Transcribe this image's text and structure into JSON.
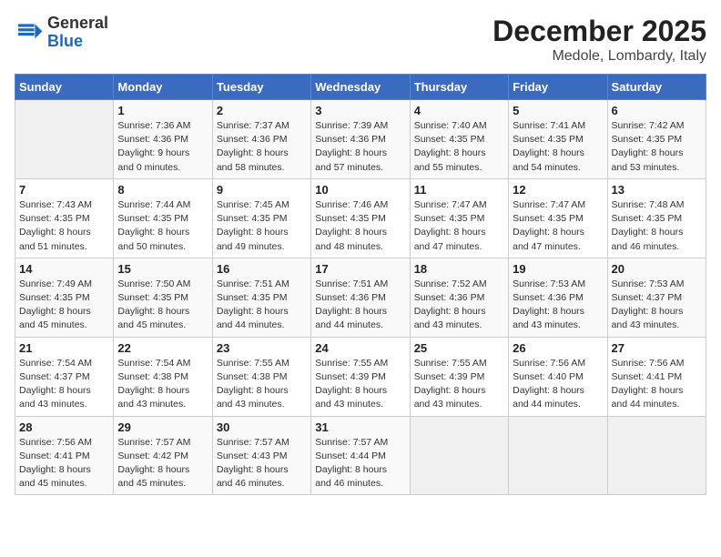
{
  "logo": {
    "general": "General",
    "blue": "Blue"
  },
  "title": "December 2025",
  "subtitle": "Medole, Lombardy, Italy",
  "weekdays": [
    "Sunday",
    "Monday",
    "Tuesday",
    "Wednesday",
    "Thursday",
    "Friday",
    "Saturday"
  ],
  "weeks": [
    [
      {
        "day": "",
        "info": ""
      },
      {
        "day": "1",
        "info": "Sunrise: 7:36 AM\nSunset: 4:36 PM\nDaylight: 9 hours\nand 0 minutes."
      },
      {
        "day": "2",
        "info": "Sunrise: 7:37 AM\nSunset: 4:36 PM\nDaylight: 8 hours\nand 58 minutes."
      },
      {
        "day": "3",
        "info": "Sunrise: 7:39 AM\nSunset: 4:36 PM\nDaylight: 8 hours\nand 57 minutes."
      },
      {
        "day": "4",
        "info": "Sunrise: 7:40 AM\nSunset: 4:35 PM\nDaylight: 8 hours\nand 55 minutes."
      },
      {
        "day": "5",
        "info": "Sunrise: 7:41 AM\nSunset: 4:35 PM\nDaylight: 8 hours\nand 54 minutes."
      },
      {
        "day": "6",
        "info": "Sunrise: 7:42 AM\nSunset: 4:35 PM\nDaylight: 8 hours\nand 53 minutes."
      }
    ],
    [
      {
        "day": "7",
        "info": "Sunrise: 7:43 AM\nSunset: 4:35 PM\nDaylight: 8 hours\nand 51 minutes."
      },
      {
        "day": "8",
        "info": "Sunrise: 7:44 AM\nSunset: 4:35 PM\nDaylight: 8 hours\nand 50 minutes."
      },
      {
        "day": "9",
        "info": "Sunrise: 7:45 AM\nSunset: 4:35 PM\nDaylight: 8 hours\nand 49 minutes."
      },
      {
        "day": "10",
        "info": "Sunrise: 7:46 AM\nSunset: 4:35 PM\nDaylight: 8 hours\nand 48 minutes."
      },
      {
        "day": "11",
        "info": "Sunrise: 7:47 AM\nSunset: 4:35 PM\nDaylight: 8 hours\nand 47 minutes."
      },
      {
        "day": "12",
        "info": "Sunrise: 7:47 AM\nSunset: 4:35 PM\nDaylight: 8 hours\nand 47 minutes."
      },
      {
        "day": "13",
        "info": "Sunrise: 7:48 AM\nSunset: 4:35 PM\nDaylight: 8 hours\nand 46 minutes."
      }
    ],
    [
      {
        "day": "14",
        "info": "Sunrise: 7:49 AM\nSunset: 4:35 PM\nDaylight: 8 hours\nand 45 minutes."
      },
      {
        "day": "15",
        "info": "Sunrise: 7:50 AM\nSunset: 4:35 PM\nDaylight: 8 hours\nand 45 minutes."
      },
      {
        "day": "16",
        "info": "Sunrise: 7:51 AM\nSunset: 4:35 PM\nDaylight: 8 hours\nand 44 minutes."
      },
      {
        "day": "17",
        "info": "Sunrise: 7:51 AM\nSunset: 4:36 PM\nDaylight: 8 hours\nand 44 minutes."
      },
      {
        "day": "18",
        "info": "Sunrise: 7:52 AM\nSunset: 4:36 PM\nDaylight: 8 hours\nand 43 minutes."
      },
      {
        "day": "19",
        "info": "Sunrise: 7:53 AM\nSunset: 4:36 PM\nDaylight: 8 hours\nand 43 minutes."
      },
      {
        "day": "20",
        "info": "Sunrise: 7:53 AM\nSunset: 4:37 PM\nDaylight: 8 hours\nand 43 minutes."
      }
    ],
    [
      {
        "day": "21",
        "info": "Sunrise: 7:54 AM\nSunset: 4:37 PM\nDaylight: 8 hours\nand 43 minutes."
      },
      {
        "day": "22",
        "info": "Sunrise: 7:54 AM\nSunset: 4:38 PM\nDaylight: 8 hours\nand 43 minutes."
      },
      {
        "day": "23",
        "info": "Sunrise: 7:55 AM\nSunset: 4:38 PM\nDaylight: 8 hours\nand 43 minutes."
      },
      {
        "day": "24",
        "info": "Sunrise: 7:55 AM\nSunset: 4:39 PM\nDaylight: 8 hours\nand 43 minutes."
      },
      {
        "day": "25",
        "info": "Sunrise: 7:55 AM\nSunset: 4:39 PM\nDaylight: 8 hours\nand 43 minutes."
      },
      {
        "day": "26",
        "info": "Sunrise: 7:56 AM\nSunset: 4:40 PM\nDaylight: 8 hours\nand 44 minutes."
      },
      {
        "day": "27",
        "info": "Sunrise: 7:56 AM\nSunset: 4:41 PM\nDaylight: 8 hours\nand 44 minutes."
      }
    ],
    [
      {
        "day": "28",
        "info": "Sunrise: 7:56 AM\nSunset: 4:41 PM\nDaylight: 8 hours\nand 45 minutes."
      },
      {
        "day": "29",
        "info": "Sunrise: 7:57 AM\nSunset: 4:42 PM\nDaylight: 8 hours\nand 45 minutes."
      },
      {
        "day": "30",
        "info": "Sunrise: 7:57 AM\nSunset: 4:43 PM\nDaylight: 8 hours\nand 46 minutes."
      },
      {
        "day": "31",
        "info": "Sunrise: 7:57 AM\nSunset: 4:44 PM\nDaylight: 8 hours\nand 46 minutes."
      },
      {
        "day": "",
        "info": ""
      },
      {
        "day": "",
        "info": ""
      },
      {
        "day": "",
        "info": ""
      }
    ]
  ]
}
